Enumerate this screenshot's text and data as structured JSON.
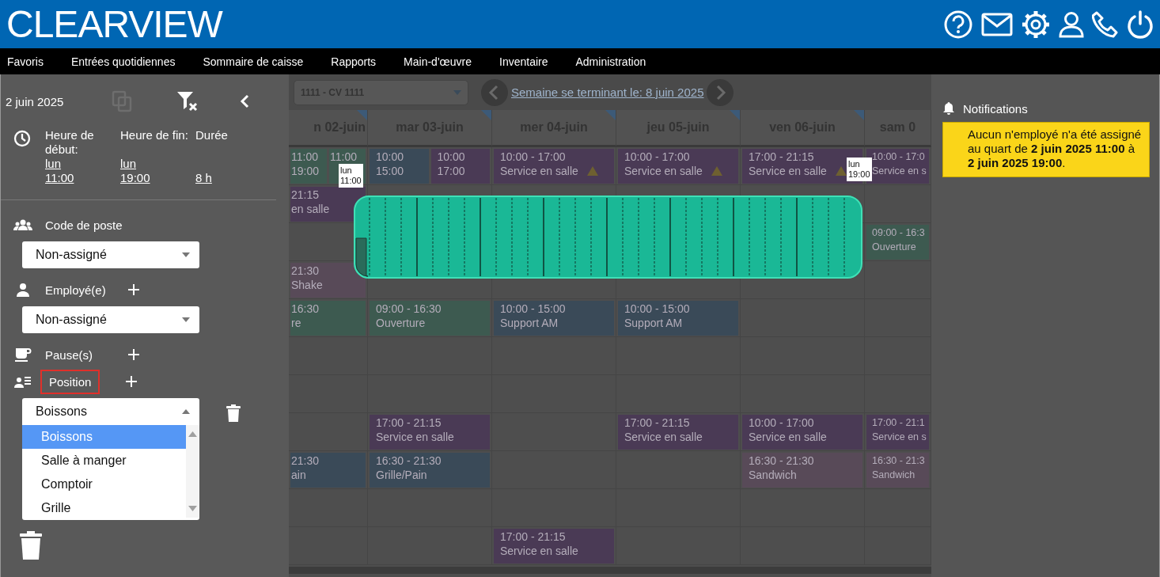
{
  "header": {
    "logo": "CLEARVIEW"
  },
  "menu": [
    "Favoris",
    "Entrées quotidiennes",
    "Sommaire de caisse",
    "Rapports",
    "Main-d'œuvre",
    "Inventaire",
    "Administration"
  ],
  "sidebar": {
    "date": "2 juin 2025",
    "times": [
      {
        "label": "Heure de début:",
        "day": "lun",
        "time": "11:00"
      },
      {
        "label": "Heure de fin:",
        "day": "lun",
        "time": "19:00"
      },
      {
        "label": "Durée",
        "time": "8 h"
      }
    ],
    "job_code": {
      "label": "Code de poste",
      "value": "Non-assigné"
    },
    "employee": {
      "label": "Employé(e)",
      "value": "Non-assigné"
    },
    "breaks": {
      "label": "Pause(s)"
    },
    "position": {
      "label": "Position",
      "highlighted": true,
      "value": "Boissons",
      "options": [
        {
          "label": "Boissons",
          "selected": true
        },
        {
          "label": "Salle à manger",
          "selected": false
        },
        {
          "label": "Comptoir",
          "selected": false
        },
        {
          "label": "Grille",
          "selected": false
        }
      ]
    }
  },
  "schedule": {
    "store_select": "1111 - CV 1111",
    "week_link": "Semaine se terminant le: 8 juin 2025",
    "days": [
      {
        "label": "n 02-juin",
        "flagged": true
      },
      {
        "label": "mar 03-juin",
        "flagged": true
      },
      {
        "label": "mer 04-juin",
        "flagged": true
      },
      {
        "label": "jeu 05-juin",
        "flagged": true
      },
      {
        "label": "ven 06-juin",
        "flagged": true
      },
      {
        "label": "sam 0",
        "flagged": false
      }
    ],
    "rows": [
      [
        {
          "shifts": [
            {
              "lines": [
                "11:00",
                "19:00"
              ],
              "color": "#3d5a50",
              "warning": false
            },
            {
              "lines": [
                "11:00"
              ],
              "color": "#3d5a50",
              "warning": false
            }
          ]
        },
        {
          "shifts": [
            {
              "lines": [
                "10:00",
                "15:00"
              ],
              "color": "#3a4a58",
              "warning": false
            },
            {
              "lines": [
                "10:00",
                "17:00"
              ],
              "color": "#4a3a55",
              "warning": false
            }
          ]
        },
        {
          "shifts": [
            {
              "lines": [
                "10:00 - 17:00",
                "Service en salle"
              ],
              "color": "#4a3a55",
              "warning": true
            }
          ]
        },
        {
          "shifts": [
            {
              "lines": [
                "10:00 - 17:00",
                "Service en salle"
              ],
              "color": "#4a3a55",
              "warning": true
            }
          ]
        },
        {
          "shifts": [
            {
              "lines": [
                "17:00 - 21:15",
                "Service en salle"
              ],
              "color": "#4a3a55",
              "warning": true
            }
          ]
        },
        {
          "shifts": [
            {
              "lines": [
                "10:00 - 17:0",
                "Service en s"
              ],
              "color": "#4a3a55",
              "warning": false
            }
          ]
        }
      ],
      [
        {
          "shifts": [
            {
              "lines": [
                "21:15",
                "en salle"
              ],
              "color": "#4a3a55",
              "warning": false
            }
          ]
        },
        {},
        {},
        {},
        {},
        {}
      ],
      [
        {},
        {},
        {},
        {},
        {},
        {
          "shifts": [
            {
              "lines": [
                "09:00 - 16:3",
                "Ouverture"
              ],
              "color": "#3d5a50",
              "warning": false
            }
          ]
        }
      ],
      [
        {
          "shifts": [
            {
              "lines": [
                "21:30",
                "Shake"
              ],
              "color": "#584a58",
              "warning": false
            }
          ]
        },
        {},
        {},
        {},
        {},
        {}
      ],
      [
        {
          "shifts": [
            {
              "lines": [
                "16:30",
                "re"
              ],
              "color": "#3d5a50",
              "warning": false
            }
          ]
        },
        {
          "shifts": [
            {
              "lines": [
                "09:00 - 16:30",
                "Ouverture"
              ],
              "color": "#3d5a50",
              "warning": false
            }
          ]
        },
        {
          "shifts": [
            {
              "lines": [
                "10:00 - 15:00",
                "Support AM"
              ],
              "color": "#3a4a58",
              "warning": false
            }
          ]
        },
        {
          "shifts": [
            {
              "lines": [
                "10:00 - 15:00",
                "Support AM"
              ],
              "color": "#3a4a58",
              "warning": false
            }
          ]
        },
        {},
        {}
      ],
      [
        {},
        {},
        {},
        {},
        {},
        {}
      ],
      [
        {},
        {},
        {},
        {},
        {},
        {}
      ],
      [
        {},
        {
          "shifts": [
            {
              "lines": [
                "17:00 - 21:15",
                "Service en salle"
              ],
              "color": "#4a3a55",
              "warning": false
            }
          ]
        },
        {},
        {
          "shifts": [
            {
              "lines": [
                "17:00 - 21:15",
                "Service en salle"
              ],
              "color": "#4a3a55",
              "warning": false
            }
          ]
        },
        {
          "shifts": [
            {
              "lines": [
                "10:00 - 17:00",
                "Service en salle"
              ],
              "color": "#4a3a55",
              "warning": false
            }
          ]
        },
        {
          "shifts": [
            {
              "lines": [
                "17:00 - 21:1",
                "Service en s"
              ],
              "color": "#4a3a55",
              "warning": false
            }
          ]
        }
      ],
      [
        {
          "shifts": [
            {
              "lines": [
                "21:30",
                "ain"
              ],
              "color": "#3a4a58",
              "warning": false
            }
          ]
        },
        {
          "shifts": [
            {
              "lines": [
                "16:30 - 21:30",
                "Grille/Pain"
              ],
              "color": "#3a4a58",
              "warning": false
            }
          ]
        },
        {},
        {},
        {
          "shifts": [
            {
              "lines": [
                "16:30 - 21:30",
                "Sandwich"
              ],
              "color": "#584a58",
              "warning": false
            }
          ]
        },
        {
          "shifts": [
            {
              "lines": [
                "16:30 - 21:3",
                "Sandwich"
              ],
              "color": "#584a58",
              "warning": false
            }
          ]
        }
      ],
      [
        {},
        {},
        {},
        {},
        {},
        {}
      ],
      [
        {},
        {},
        {
          "shifts": [
            {
              "lines": [
                "17:00 - 21:15",
                "Service en salle"
              ],
              "color": "#4a3a55",
              "warning": false
            }
          ]
        },
        {},
        {},
        {}
      ]
    ],
    "drag": {
      "start": {
        "day": "lun",
        "time": "11:00"
      },
      "end": {
        "day": "lun",
        "time": "19:00"
      }
    }
  },
  "notifications": {
    "title": "Notifications",
    "message": "Aucun n'employé n'a été assigné au quart de **2 juin 2025 11:00** à **2 juin 2025 19:00**."
  }
}
